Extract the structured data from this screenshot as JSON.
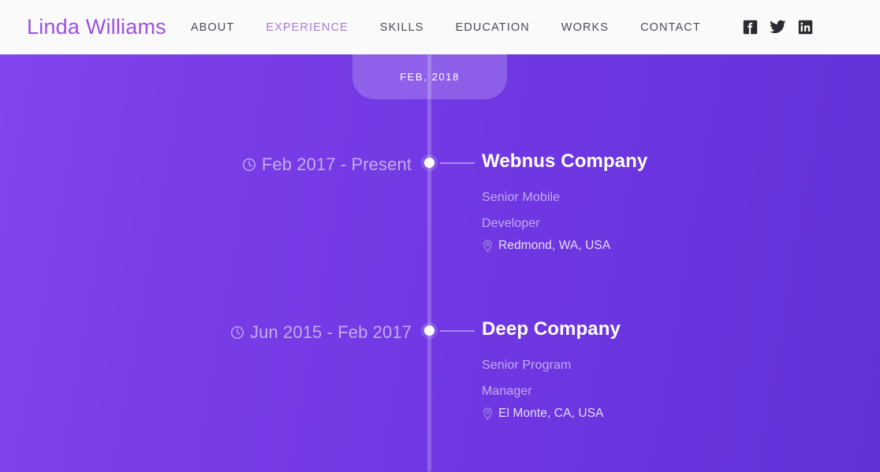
{
  "header": {
    "brand": "Linda Williams",
    "nav": [
      {
        "label": "ABOUT",
        "active": false
      },
      {
        "label": "EXPERIENCE",
        "active": true
      },
      {
        "label": "SKILLS",
        "active": false
      },
      {
        "label": "EDUCATION",
        "active": false
      },
      {
        "label": "WORKS",
        "active": false
      },
      {
        "label": "CONTACT",
        "active": false
      }
    ],
    "socials": [
      {
        "name": "facebook-icon"
      },
      {
        "name": "twitter-icon"
      },
      {
        "name": "linkedin-icon"
      }
    ]
  },
  "timeline": {
    "badge_label": "FEB, 2018",
    "entries": [
      {
        "date": "Feb 2017 - Present",
        "company": "Webnus Company",
        "role": "Senior Mobile Developer",
        "location": "Redmond, WA, USA"
      },
      {
        "date": "Jun 2015 - Feb 2017",
        "company": "Deep Company",
        "role": "Senior Program Manager",
        "location": "El Monte, CA, USA"
      }
    ]
  },
  "colors": {
    "brand_purple": "#9B51E0",
    "active_nav": "#A87BD9",
    "nav_text": "#4C4C52",
    "header_bg": "#FBFAFB",
    "stage_from": "#8246F0",
    "stage_to": "#6232D8",
    "muted_text": "#C3ACEE",
    "white": "#FFFFFF"
  }
}
